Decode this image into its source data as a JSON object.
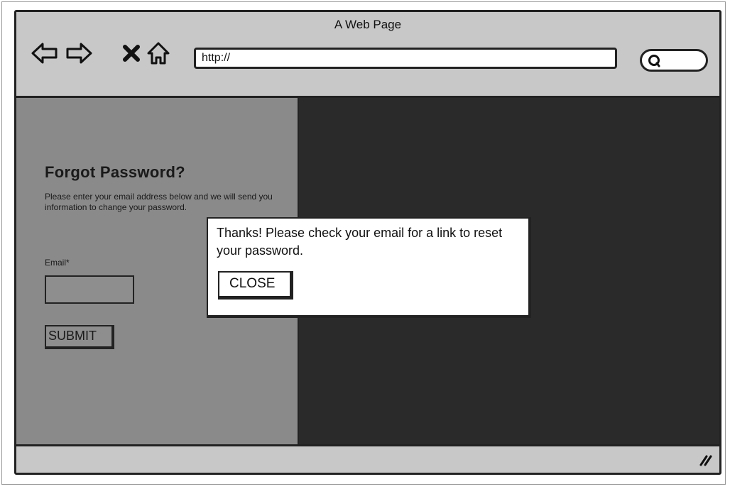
{
  "window": {
    "title": "A Web Page"
  },
  "toolbar": {
    "icons": [
      "back-arrow-icon",
      "forward-arrow-icon",
      "close-x-icon",
      "home-icon"
    ],
    "url_value": "http://",
    "search_icon": "search-icon"
  },
  "form": {
    "title": "Forgot Password?",
    "description": "Please enter your email address below and we will send you information to change your password.",
    "email_label": "Email*",
    "email_value": "",
    "submit_label": "SUBMIT"
  },
  "dialog": {
    "message": "Thanks! Please check your email for a link to reset your password.",
    "close_label": "CLOSE"
  },
  "status_bar": {
    "grip_icon": "resize-grip-icon"
  },
  "colors": {
    "chrome": "#c8c8c8",
    "left_panel": "#8a8a8a",
    "overlay": "#2a2a2a",
    "dialog": "#ffffff",
    "stroke": "#222222"
  }
}
